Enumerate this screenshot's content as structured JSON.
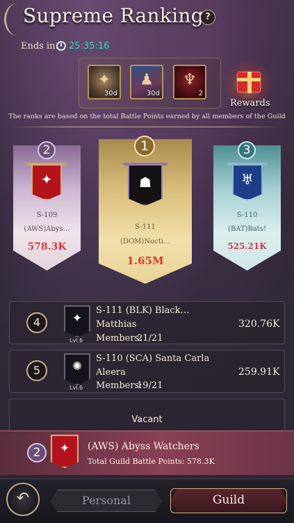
{
  "header": {
    "title": "Supreme Rankings",
    "help_glyph": "?",
    "ends_label": "Ends in:",
    "timer": "25:35:16"
  },
  "rewards": {
    "items": [
      {
        "icon": "crest-badge-icon",
        "badge": "30d"
      },
      {
        "icon": "portrait-frame-icon",
        "badge": "30d"
      },
      {
        "icon": "winged-emblem-icon",
        "badge": "2"
      }
    ],
    "button_label": "Rewards"
  },
  "info_text": "The ranks are based on the total Battle Points earned by all members of the Guild",
  "podium": [
    {
      "rank": "2",
      "server": "S-109",
      "name": "(AWS)Abys…",
      "points": "578.3K",
      "banner_color": "#b3141c"
    },
    {
      "rank": "1",
      "server": "S-111",
      "name": "(DOM)Nocti…",
      "points": "1.65M",
      "banner_color": "#141214"
    },
    {
      "rank": "3",
      "server": "S-110",
      "name": "(BAT)Bats!",
      "points": "525.21K",
      "banner_color": "#1d3f8a"
    }
  ],
  "rows": [
    {
      "rank": "4",
      "guild": "S-111 (BLK) Black…",
      "leader": "Matthias",
      "members_label": "Members:",
      "members": "21/21",
      "points": "320.76K",
      "level": "Lvl.6"
    },
    {
      "rank": "5",
      "guild": "S-110 (SCA) Santa Carla",
      "leader": "Aleera",
      "members_label": "Members:",
      "members": "19/21",
      "points": "259.91K",
      "level": "Lvl.6"
    }
  ],
  "vacant_label": "Vacant",
  "my_guild": {
    "rank": "2",
    "name": "(AWS) Abyss Watchers",
    "points_label": "Total Guild Battle Points: 578.3K"
  },
  "tabs": {
    "personal": "Personal",
    "guild": "Guild",
    "active": "guild"
  },
  "colors": {
    "timer": "#34d7b8",
    "points_highlight": "#d63a2a"
  }
}
